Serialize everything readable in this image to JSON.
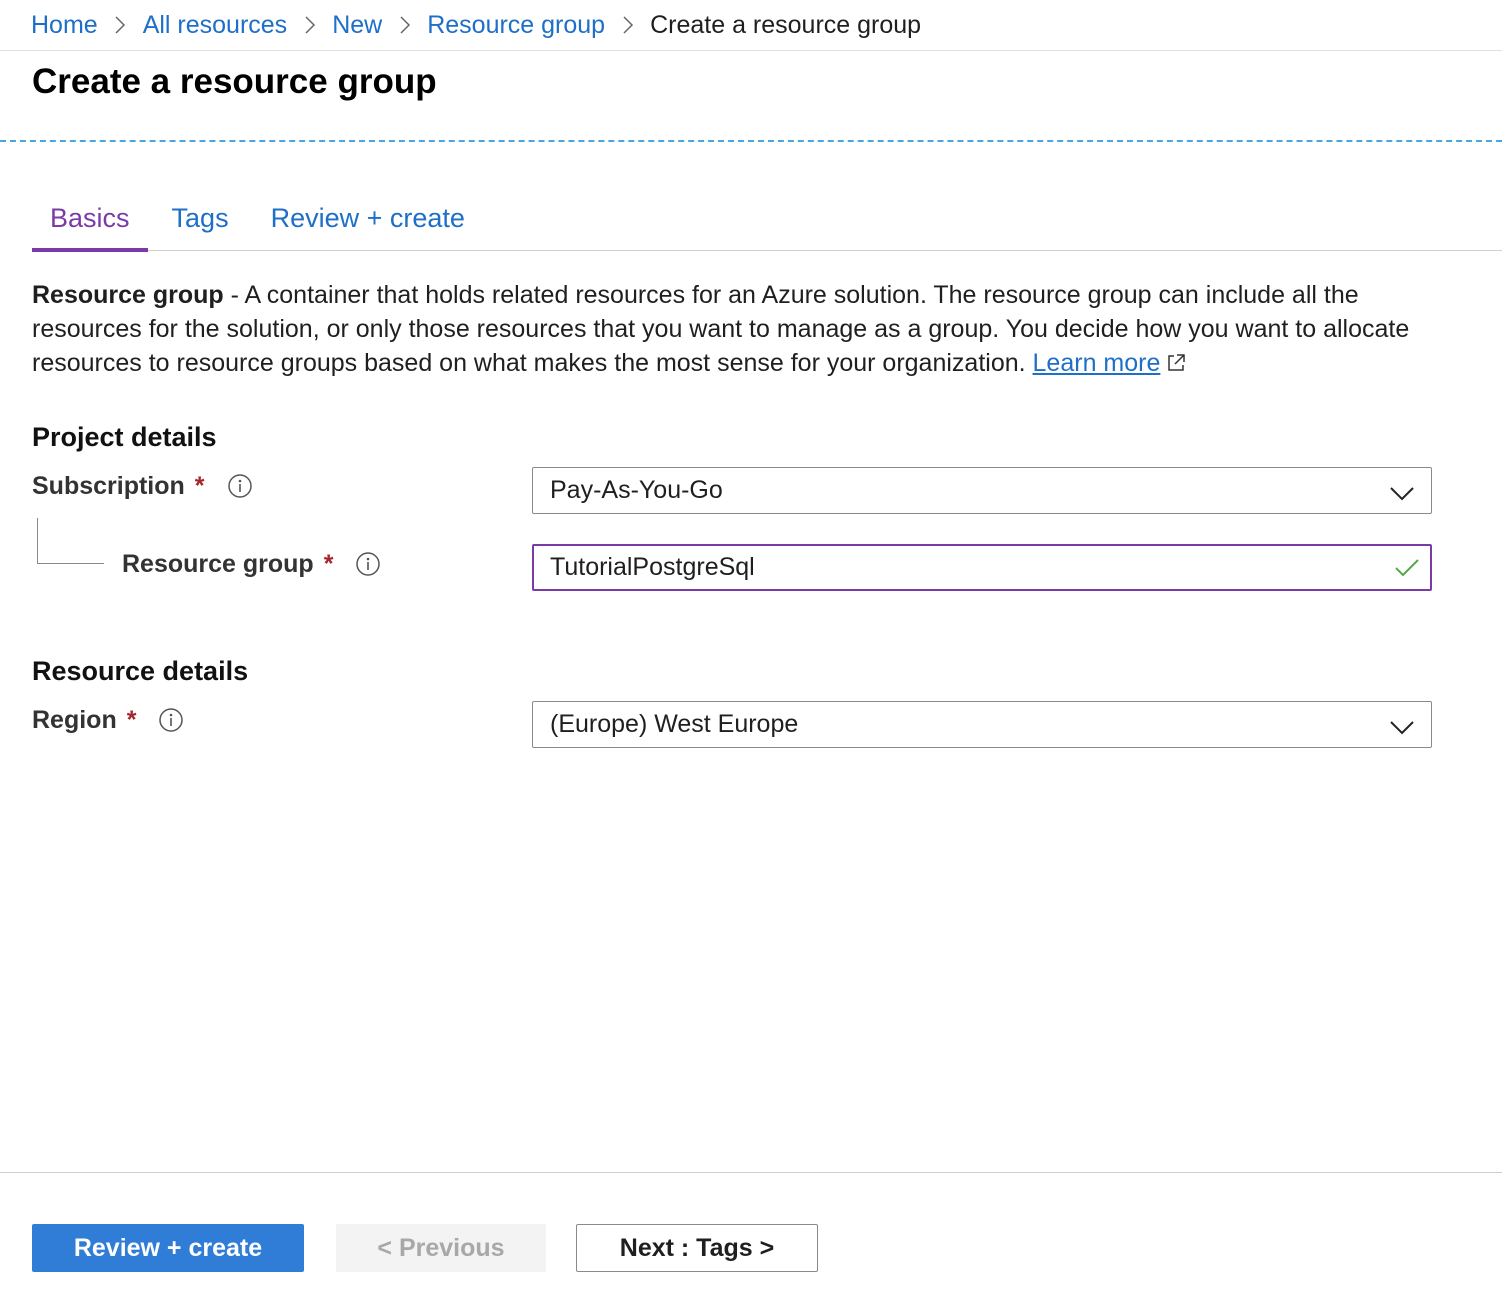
{
  "breadcrumb": {
    "items": [
      "Home",
      "All resources",
      "New",
      "Resource group"
    ],
    "current": "Create a resource group"
  },
  "page": {
    "title": "Create a resource group"
  },
  "tabs": [
    {
      "label": "Basics",
      "active": true
    },
    {
      "label": "Tags",
      "active": false
    },
    {
      "label": "Review + create",
      "active": false
    }
  ],
  "description": {
    "term": "Resource group",
    "text": " - A container that holds related resources for an Azure solution. The resource group can include all the resources for the solution, or only those resources that you want to manage as a group. You decide how you want to allocate resources to resource groups based on what makes the most sense for your organization. ",
    "learn_more": "Learn more"
  },
  "project_details": {
    "title": "Project details",
    "subscription": {
      "label": "Subscription",
      "required": "*",
      "value": "Pay-As-You-Go"
    },
    "resource_group": {
      "label": "Resource group",
      "required": "*",
      "value": "TutorialPostgreSql"
    }
  },
  "resource_details": {
    "title": "Resource details",
    "region": {
      "label": "Region",
      "required": "*",
      "value": "(Europe) West Europe"
    }
  },
  "footer": {
    "review_create": "Review + create",
    "previous": "< Previous",
    "next": "Next : Tags >"
  },
  "colors": {
    "link": "#1e6fc7",
    "accent": "#7a3aa8",
    "primary_button": "#2f7dd7",
    "valid": "#57a64a",
    "required": "#a4262c"
  },
  "icons": {
    "breadcrumb_separator": "chevron-right-icon",
    "external_link": "external-link-icon",
    "info": "info-icon",
    "dropdown": "chevron-down-icon",
    "valid": "checkmark-icon"
  }
}
